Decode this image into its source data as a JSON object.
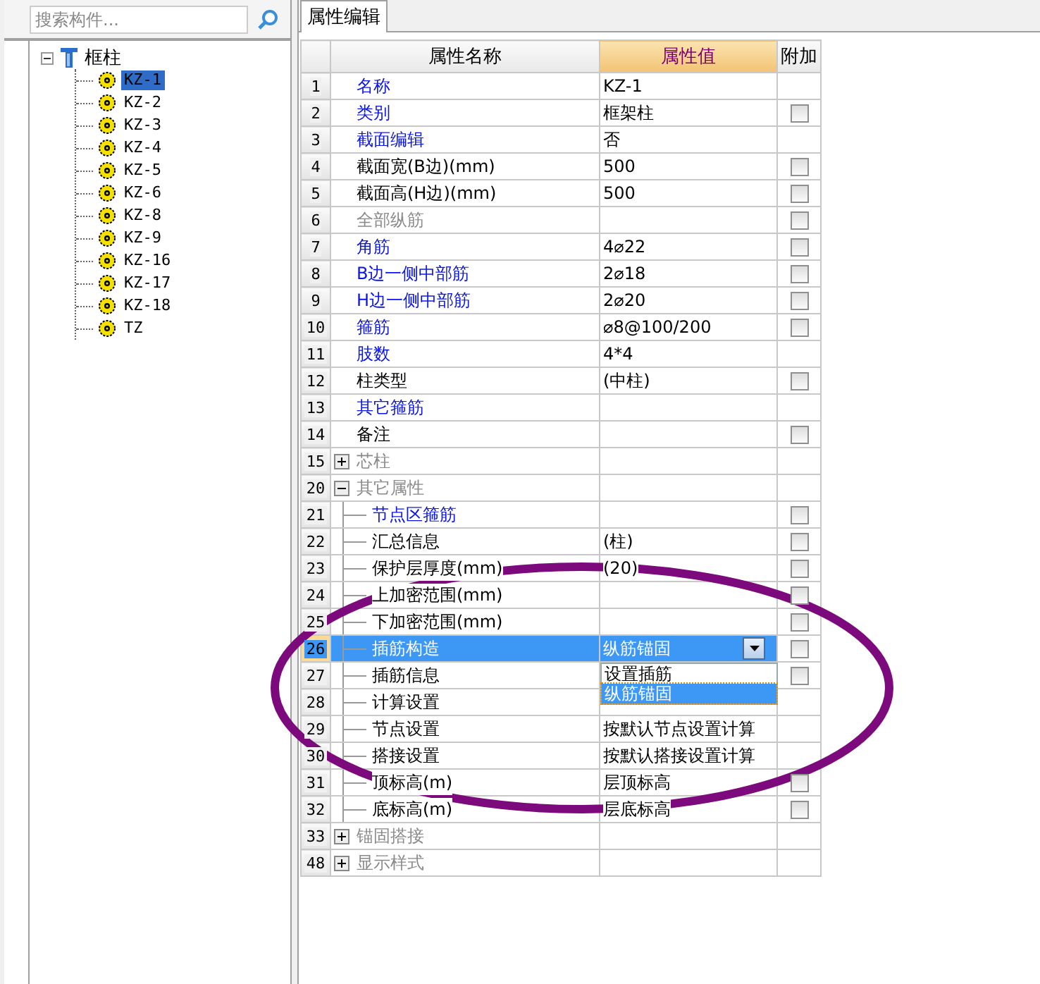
{
  "search": {
    "placeholder": "搜索构件..."
  },
  "tree": {
    "label": "框柱",
    "expanded": true,
    "children": [
      {
        "label": "KZ-1",
        "selected": true
      },
      {
        "label": "KZ-2",
        "selected": false
      },
      {
        "label": "KZ-3",
        "selected": false
      },
      {
        "label": "KZ-4",
        "selected": false
      },
      {
        "label": "KZ-5",
        "selected": false
      },
      {
        "label": "KZ-6",
        "selected": false
      },
      {
        "label": "KZ-8",
        "selected": false
      },
      {
        "label": "KZ-9",
        "selected": false
      },
      {
        "label": "KZ-16",
        "selected": false
      },
      {
        "label": "KZ-17",
        "selected": false
      },
      {
        "label": "KZ-18",
        "selected": false
      },
      {
        "label": "TZ",
        "selected": false
      }
    ]
  },
  "tab": {
    "label": "属性编辑",
    "selected": true
  },
  "table": {
    "columns": [
      "属性名称",
      "属性值",
      "附加"
    ],
    "rows": [
      {
        "num": "1",
        "name": "名称",
        "value": "KZ-1",
        "kind": "link",
        "selected": false
      },
      {
        "num": "2",
        "name": "类别",
        "value": "框架柱",
        "kind": "link",
        "selected": false,
        "checked": false
      },
      {
        "num": "3",
        "name": "截面编辑",
        "value": "否",
        "kind": "link",
        "selected": false
      },
      {
        "num": "4",
        "name": "截面宽(B边)(mm)",
        "value": "500",
        "kind": "plain",
        "selected": false,
        "checked": false
      },
      {
        "num": "5",
        "name": "截面高(H边)(mm)",
        "value": "500",
        "kind": "plain",
        "selected": false,
        "checked": false
      },
      {
        "num": "6",
        "name": "全部纵筋",
        "kind": "muted",
        "selected": false,
        "checked": false
      },
      {
        "num": "7",
        "name": "角筋",
        "value": "4⌀22",
        "kind": "link",
        "selected": false,
        "checked": false
      },
      {
        "num": "8",
        "name": "B边一侧中部筋",
        "value": "2⌀18",
        "kind": "link",
        "selected": false,
        "checked": false
      },
      {
        "num": "9",
        "name": "H边一侧中部筋",
        "value": "2⌀20",
        "kind": "link",
        "selected": false,
        "checked": false
      },
      {
        "num": "10",
        "name": "箍筋",
        "value": "⌀8@100/200",
        "kind": "link",
        "selected": false,
        "checked": false
      },
      {
        "num": "11",
        "name": "肢数",
        "value": "4*4",
        "kind": "link",
        "selected": false
      },
      {
        "num": "12",
        "name": "柱类型",
        "value": "(中柱)",
        "kind": "plain",
        "selected": false,
        "checked": false
      },
      {
        "num": "13",
        "name": "其它箍筋",
        "kind": "link",
        "selected": false
      },
      {
        "num": "14",
        "name": "备注",
        "kind": "plain",
        "selected": false,
        "checked": false
      },
      {
        "num": "15",
        "name": "芯柱",
        "kind": "muted",
        "selected": false,
        "expanded": false
      },
      {
        "num": "20",
        "name": "其它属性",
        "kind": "muted",
        "selected": false,
        "expanded": true,
        "children": [
          {
            "num": "21",
            "name": "节点区箍筋",
            "kind": "link",
            "selected": false,
            "checked": false
          },
          {
            "num": "22",
            "name": "汇总信息",
            "value": "(柱)",
            "kind": "plain",
            "selected": false,
            "checked": false
          },
          {
            "num": "23",
            "name": "保护层厚度(mm)",
            "value": "(20)",
            "kind": "plain",
            "selected": false,
            "checked": false
          },
          {
            "num": "24",
            "name": "上加密范围(mm)",
            "kind": "plain",
            "selected": false,
            "checked": false
          },
          {
            "num": "25",
            "name": "下加密范围(mm)",
            "kind": "plain",
            "selected": false,
            "checked": false
          },
          {
            "num": "26",
            "name": "插筋构造",
            "value": "纵筋锚固",
            "kind": "plain",
            "selected": true,
            "checked": false,
            "dropdown": [
              {
                "label": "设置插筋",
                "selected": false
              },
              {
                "label": "纵筋锚固",
                "selected": true
              }
            ]
          },
          {
            "num": "27",
            "name": "插筋信息",
            "kind": "plain",
            "selected": false,
            "checked": false
          },
          {
            "num": "28",
            "name": "计算设置",
            "kind": "plain",
            "selected": false
          },
          {
            "num": "29",
            "name": "节点设置",
            "value": "按默认节点设置计算",
            "kind": "plain",
            "selected": false
          },
          {
            "num": "30",
            "name": "搭接设置",
            "value": "按默认搭接设置计算",
            "kind": "plain",
            "selected": false
          },
          {
            "num": "31",
            "name": "顶标高(m)",
            "value": "层顶标高",
            "kind": "plain",
            "selected": false,
            "checked": false
          },
          {
            "num": "32",
            "name": "底标高(m)",
            "value": "层底标高",
            "kind": "plain",
            "selected": false,
            "checked": false
          }
        ]
      },
      {
        "num": "33",
        "name": "锚固搭接",
        "kind": "muted",
        "selected": false,
        "expanded": false
      },
      {
        "num": "48",
        "name": "显示样式",
        "kind": "muted",
        "selected": false,
        "expanded": false
      }
    ]
  }
}
